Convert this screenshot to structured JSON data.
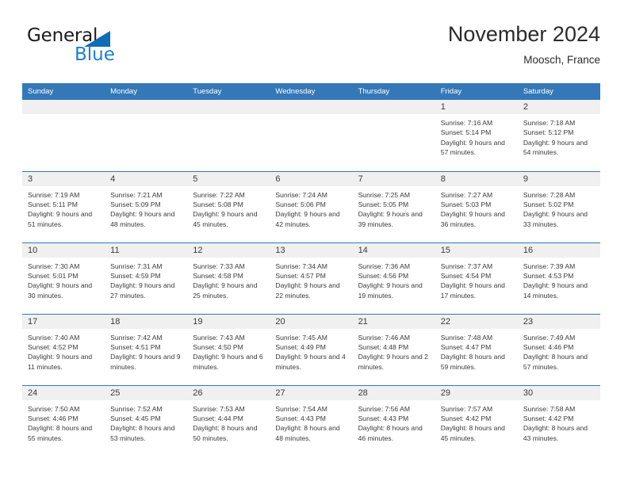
{
  "logo": {
    "word1": "General",
    "word2": "Blue",
    "triangle_color": "#0f6cb5",
    "word2_color": "#1b7fd4"
  },
  "header": {
    "title": "November 2024",
    "subtitle": "Moosch, France"
  },
  "theme": {
    "header_blue": "#3478b8",
    "daynum_band": "#f0f0f0",
    "text": "#3a3a3a"
  },
  "weekday_headers": [
    "Sunday",
    "Monday",
    "Tuesday",
    "Wednesday",
    "Thursday",
    "Friday",
    "Saturday"
  ],
  "labels": {
    "sunrise_prefix": "Sunrise:",
    "sunset_prefix": "Sunset:",
    "daylight_prefix": "Daylight:"
  },
  "weeks": [
    [
      {
        "day": "",
        "sunrise": "",
        "sunset": "",
        "daylight": "",
        "empty": true
      },
      {
        "day": "",
        "sunrise": "",
        "sunset": "",
        "daylight": "",
        "empty": true
      },
      {
        "day": "",
        "sunrise": "",
        "sunset": "",
        "daylight": "",
        "empty": true
      },
      {
        "day": "",
        "sunrise": "",
        "sunset": "",
        "daylight": "",
        "empty": true
      },
      {
        "day": "",
        "sunrise": "",
        "sunset": "",
        "daylight": "",
        "empty": true
      },
      {
        "day": "1",
        "sunrise": "Sunrise: 7:16 AM",
        "sunset": "Sunset: 5:14 PM",
        "daylight": "Daylight: 9 hours and 57 minutes.",
        "empty": false
      },
      {
        "day": "2",
        "sunrise": "Sunrise: 7:18 AM",
        "sunset": "Sunset: 5:12 PM",
        "daylight": "Daylight: 9 hours and 54 minutes.",
        "empty": false
      }
    ],
    [
      {
        "day": "3",
        "sunrise": "Sunrise: 7:19 AM",
        "sunset": "Sunset: 5:11 PM",
        "daylight": "Daylight: 9 hours and 51 minutes.",
        "empty": false
      },
      {
        "day": "4",
        "sunrise": "Sunrise: 7:21 AM",
        "sunset": "Sunset: 5:09 PM",
        "daylight": "Daylight: 9 hours and 48 minutes.",
        "empty": false
      },
      {
        "day": "5",
        "sunrise": "Sunrise: 7:22 AM",
        "sunset": "Sunset: 5:08 PM",
        "daylight": "Daylight: 9 hours and 45 minutes.",
        "empty": false
      },
      {
        "day": "6",
        "sunrise": "Sunrise: 7:24 AM",
        "sunset": "Sunset: 5:06 PM",
        "daylight": "Daylight: 9 hours and 42 minutes.",
        "empty": false
      },
      {
        "day": "7",
        "sunrise": "Sunrise: 7:25 AM",
        "sunset": "Sunset: 5:05 PM",
        "daylight": "Daylight: 9 hours and 39 minutes.",
        "empty": false
      },
      {
        "day": "8",
        "sunrise": "Sunrise: 7:27 AM",
        "sunset": "Sunset: 5:03 PM",
        "daylight": "Daylight: 9 hours and 36 minutes.",
        "empty": false
      },
      {
        "day": "9",
        "sunrise": "Sunrise: 7:28 AM",
        "sunset": "Sunset: 5:02 PM",
        "daylight": "Daylight: 9 hours and 33 minutes.",
        "empty": false
      }
    ],
    [
      {
        "day": "10",
        "sunrise": "Sunrise: 7:30 AM",
        "sunset": "Sunset: 5:01 PM",
        "daylight": "Daylight: 9 hours and 30 minutes.",
        "empty": false
      },
      {
        "day": "11",
        "sunrise": "Sunrise: 7:31 AM",
        "sunset": "Sunset: 4:59 PM",
        "daylight": "Daylight: 9 hours and 27 minutes.",
        "empty": false
      },
      {
        "day": "12",
        "sunrise": "Sunrise: 7:33 AM",
        "sunset": "Sunset: 4:58 PM",
        "daylight": "Daylight: 9 hours and 25 minutes.",
        "empty": false
      },
      {
        "day": "13",
        "sunrise": "Sunrise: 7:34 AM",
        "sunset": "Sunset: 4:57 PM",
        "daylight": "Daylight: 9 hours and 22 minutes.",
        "empty": false
      },
      {
        "day": "14",
        "sunrise": "Sunrise: 7:36 AM",
        "sunset": "Sunset: 4:56 PM",
        "daylight": "Daylight: 9 hours and 19 minutes.",
        "empty": false
      },
      {
        "day": "15",
        "sunrise": "Sunrise: 7:37 AM",
        "sunset": "Sunset: 4:54 PM",
        "daylight": "Daylight: 9 hours and 17 minutes.",
        "empty": false
      },
      {
        "day": "16",
        "sunrise": "Sunrise: 7:39 AM",
        "sunset": "Sunset: 4:53 PM",
        "daylight": "Daylight: 9 hours and 14 minutes.",
        "empty": false
      }
    ],
    [
      {
        "day": "17",
        "sunrise": "Sunrise: 7:40 AM",
        "sunset": "Sunset: 4:52 PM",
        "daylight": "Daylight: 9 hours and 11 minutes.",
        "empty": false
      },
      {
        "day": "18",
        "sunrise": "Sunrise: 7:42 AM",
        "sunset": "Sunset: 4:51 PM",
        "daylight": "Daylight: 9 hours and 9 minutes.",
        "empty": false
      },
      {
        "day": "19",
        "sunrise": "Sunrise: 7:43 AM",
        "sunset": "Sunset: 4:50 PM",
        "daylight": "Daylight: 9 hours and 6 minutes.",
        "empty": false
      },
      {
        "day": "20",
        "sunrise": "Sunrise: 7:45 AM",
        "sunset": "Sunset: 4:49 PM",
        "daylight": "Daylight: 9 hours and 4 minutes.",
        "empty": false
      },
      {
        "day": "21",
        "sunrise": "Sunrise: 7:46 AM",
        "sunset": "Sunset: 4:48 PM",
        "daylight": "Daylight: 9 hours and 2 minutes.",
        "empty": false
      },
      {
        "day": "22",
        "sunrise": "Sunrise: 7:48 AM",
        "sunset": "Sunset: 4:47 PM",
        "daylight": "Daylight: 8 hours and 59 minutes.",
        "empty": false
      },
      {
        "day": "23",
        "sunrise": "Sunrise: 7:49 AM",
        "sunset": "Sunset: 4:46 PM",
        "daylight": "Daylight: 8 hours and 57 minutes.",
        "empty": false
      }
    ],
    [
      {
        "day": "24",
        "sunrise": "Sunrise: 7:50 AM",
        "sunset": "Sunset: 4:46 PM",
        "daylight": "Daylight: 8 hours and 55 minutes.",
        "empty": false
      },
      {
        "day": "25",
        "sunrise": "Sunrise: 7:52 AM",
        "sunset": "Sunset: 4:45 PM",
        "daylight": "Daylight: 8 hours and 53 minutes.",
        "empty": false
      },
      {
        "day": "26",
        "sunrise": "Sunrise: 7:53 AM",
        "sunset": "Sunset: 4:44 PM",
        "daylight": "Daylight: 8 hours and 50 minutes.",
        "empty": false
      },
      {
        "day": "27",
        "sunrise": "Sunrise: 7:54 AM",
        "sunset": "Sunset: 4:43 PM",
        "daylight": "Daylight: 8 hours and 48 minutes.",
        "empty": false
      },
      {
        "day": "28",
        "sunrise": "Sunrise: 7:56 AM",
        "sunset": "Sunset: 4:43 PM",
        "daylight": "Daylight: 8 hours and 46 minutes.",
        "empty": false
      },
      {
        "day": "29",
        "sunrise": "Sunrise: 7:57 AM",
        "sunset": "Sunset: 4:42 PM",
        "daylight": "Daylight: 8 hours and 45 minutes.",
        "empty": false
      },
      {
        "day": "30",
        "sunrise": "Sunrise: 7:58 AM",
        "sunset": "Sunset: 4:42 PM",
        "daylight": "Daylight: 8 hours and 43 minutes.",
        "empty": false
      }
    ]
  ]
}
